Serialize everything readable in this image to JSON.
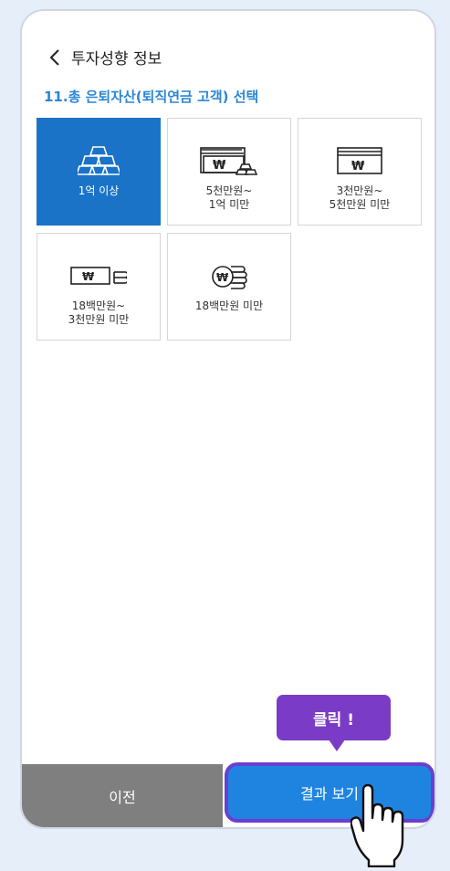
{
  "header": {
    "title": "투자성향 정보",
    "back_icon": "chevron-left-icon"
  },
  "question": "11.총 은퇴자산(퇴직연금 고객) 선택",
  "options": [
    {
      "label": "1억 이상",
      "icon": "gold-bars-icon",
      "selected": true
    },
    {
      "label": "5천만원~\n1억 미만",
      "icon": "cash-bundle-gold-icon",
      "selected": false
    },
    {
      "label": "3천만원~\n5천만원 미만",
      "icon": "cash-bundle-icon",
      "selected": false
    },
    {
      "label": "18백만원~\n3천만원 미만",
      "icon": "banknote-coins-icon",
      "selected": false
    },
    {
      "label": "18백만원 미만",
      "icon": "coin-stack-icon",
      "selected": false
    }
  ],
  "footer": {
    "prev_label": "이전",
    "result_label": "결과 보기"
  },
  "tooltip": "클릭 !",
  "colors": {
    "accent": "#1a73c7",
    "question": "#2a86d6",
    "highlight": "#7a3cc6",
    "prev_bg": "#7f7f7f"
  }
}
